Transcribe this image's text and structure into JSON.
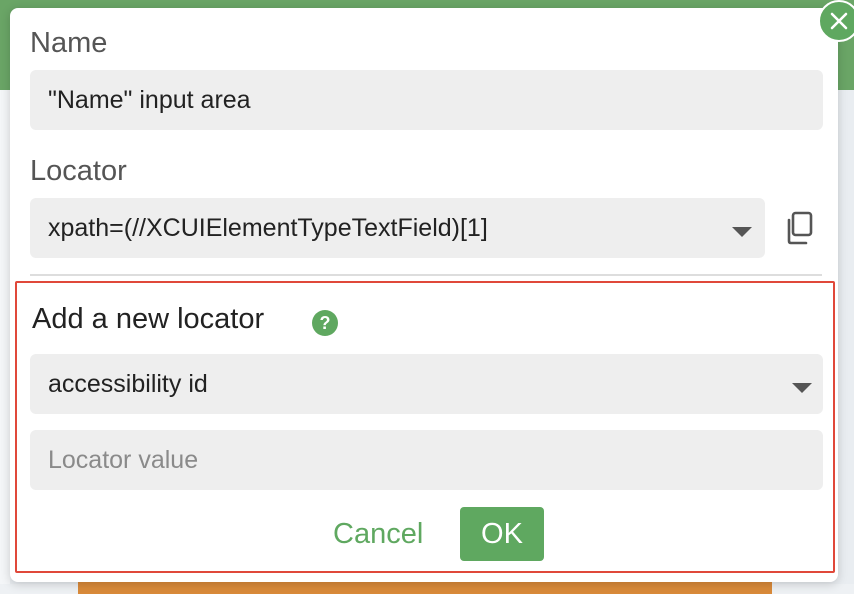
{
  "dialog": {
    "name_label": "Name",
    "name_value": "\"Name\" input area",
    "locator_label": "Locator",
    "locator_value": "xpath=(//XCUIElementTypeTextField)[1]",
    "new_locator": {
      "title": "Add a new locator",
      "help_symbol": "?",
      "strategy_value": "accessibility id",
      "value_placeholder": "Locator value",
      "cancel_label": "Cancel",
      "ok_label": "OK"
    }
  },
  "icons": {
    "close": "close-icon",
    "copy": "copy-icon",
    "help": "help-icon",
    "dropdown": "chevron-down-icon"
  },
  "colors": {
    "accent_green": "#5fa860",
    "highlight_red": "#e0483a",
    "field_bg": "#eeeeee"
  }
}
